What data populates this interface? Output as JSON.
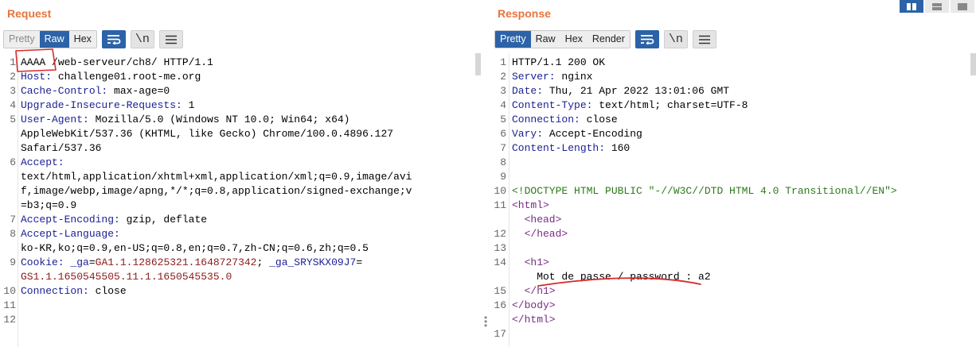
{
  "request": {
    "title": "Request",
    "tabs": [
      "Pretty",
      "Raw",
      "Hex"
    ],
    "active_tab": "Raw",
    "newline_toggle": "\\n",
    "lines": [
      {
        "n": "1",
        "parts": [
          {
            "t": "AAAA",
            "c": "v"
          },
          {
            "t": " /web-serveur/ch8/ HTTP/1.1",
            "c": "v"
          }
        ]
      },
      {
        "n": "2",
        "parts": [
          {
            "t": "Host:",
            "c": "k"
          },
          {
            "t": " challenge01.root-me.org",
            "c": "v"
          }
        ]
      },
      {
        "n": "3",
        "parts": [
          {
            "t": "Cache-Control:",
            "c": "k"
          },
          {
            "t": " max-age=0",
            "c": "v"
          }
        ]
      },
      {
        "n": "4",
        "parts": [
          {
            "t": "Upgrade-Insecure-Requests:",
            "c": "k"
          },
          {
            "t": " 1",
            "c": "v"
          }
        ]
      },
      {
        "n": "5",
        "parts": [
          {
            "t": "User-Agent:",
            "c": "k"
          },
          {
            "t": " Mozilla/5.0 (Windows NT 10.0; Win64; x64)",
            "c": "v"
          }
        ]
      },
      {
        "n": "",
        "parts": [
          {
            "t": "AppleWebKit/537.36 (KHTML, like Gecko) Chrome/100.0.4896.127",
            "c": "v"
          }
        ]
      },
      {
        "n": "",
        "parts": [
          {
            "t": "Safari/537.36",
            "c": "v"
          }
        ]
      },
      {
        "n": "6",
        "parts": [
          {
            "t": "Accept:",
            "c": "k"
          }
        ]
      },
      {
        "n": "",
        "parts": [
          {
            "t": "text/html,application/xhtml+xml,application/xml;q=0.9,image/avi",
            "c": "v"
          }
        ]
      },
      {
        "n": "",
        "parts": [
          {
            "t": "f,image/webp,image/apng,*/*;q=0.8,application/signed-exchange;v",
            "c": "v"
          }
        ]
      },
      {
        "n": "",
        "parts": [
          {
            "t": "=b3;q=0.9",
            "c": "v"
          }
        ]
      },
      {
        "n": "7",
        "parts": [
          {
            "t": "Accept-Encoding:",
            "c": "k"
          },
          {
            "t": " gzip, deflate",
            "c": "v"
          }
        ]
      },
      {
        "n": "8",
        "parts": [
          {
            "t": "Accept-Language:",
            "c": "k"
          }
        ]
      },
      {
        "n": "",
        "parts": [
          {
            "t": "ko-KR,ko;q=0.9,en-US;q=0.8,en;q=0.7,zh-CN;q=0.6,zh;q=0.5",
            "c": "v"
          }
        ]
      },
      {
        "n": "9",
        "parts": [
          {
            "t": "Cookie:",
            "c": "k"
          },
          {
            "t": " _ga",
            "c": "ck"
          },
          {
            "t": "=",
            "c": "v"
          },
          {
            "t": "GA1.1.128625321.1648727342",
            "c": "cv"
          },
          {
            "t": "; ",
            "c": "v"
          },
          {
            "t": "_ga_SRYSKX09J7",
            "c": "ck"
          },
          {
            "t": "=",
            "c": "v"
          }
        ]
      },
      {
        "n": "",
        "parts": [
          {
            "t": "GS1.1.1650545505.11.1.1650545535.0",
            "c": "cv"
          }
        ]
      },
      {
        "n": "10",
        "parts": [
          {
            "t": "Connection:",
            "c": "k"
          },
          {
            "t": " close",
            "c": "v"
          }
        ]
      },
      {
        "n": "11",
        "parts": []
      },
      {
        "n": "12",
        "parts": []
      }
    ]
  },
  "response": {
    "title": "Response",
    "tabs": [
      "Pretty",
      "Raw",
      "Hex",
      "Render"
    ],
    "active_tab": "Pretty",
    "newline_toggle": "\\n",
    "lines": [
      {
        "n": "1",
        "parts": [
          {
            "t": "HTTP/1.1 200 OK",
            "c": "v"
          }
        ]
      },
      {
        "n": "2",
        "parts": [
          {
            "t": "Server:",
            "c": "k"
          },
          {
            "t": " nginx",
            "c": "v"
          }
        ]
      },
      {
        "n": "3",
        "parts": [
          {
            "t": "Date:",
            "c": "k"
          },
          {
            "t": " Thu, 21 Apr 2022 13:01:06 GMT",
            "c": "v"
          }
        ]
      },
      {
        "n": "4",
        "parts": [
          {
            "t": "Content-Type:",
            "c": "k"
          },
          {
            "t": " text/html; charset=UTF-8",
            "c": "v"
          }
        ]
      },
      {
        "n": "5",
        "parts": [
          {
            "t": "Connection:",
            "c": "k"
          },
          {
            "t": " close",
            "c": "v"
          }
        ]
      },
      {
        "n": "6",
        "parts": [
          {
            "t": "Vary:",
            "c": "k"
          },
          {
            "t": " Accept-Encoding",
            "c": "v"
          }
        ]
      },
      {
        "n": "7",
        "parts": [
          {
            "t": "Content-Length:",
            "c": "k"
          },
          {
            "t": " 160",
            "c": "v"
          }
        ]
      },
      {
        "n": "8",
        "parts": []
      },
      {
        "n": "9",
        "parts": []
      },
      {
        "n": "10",
        "parts": [
          {
            "t": "<!DOCTYPE HTML PUBLIC \"-//W3C//DTD HTML 4.0 Transitional//EN\">",
            "c": "dt"
          }
        ]
      },
      {
        "n": "11",
        "parts": [
          {
            "t": "<html>",
            "c": "tag"
          }
        ]
      },
      {
        "n": "",
        "parts": [
          {
            "t": "  <head>",
            "c": "tag"
          }
        ]
      },
      {
        "n": "12",
        "parts": [
          {
            "t": "  </head>",
            "c": "tag"
          }
        ]
      },
      {
        "n": "13",
        "parts": []
      },
      {
        "n": "14",
        "parts": [
          {
            "t": "  <h1>",
            "c": "tag"
          }
        ]
      },
      {
        "n": "",
        "parts": [
          {
            "t": "    Mot de passe / password : a2",
            "c": "v"
          }
        ]
      },
      {
        "n": "15",
        "parts": [
          {
            "t": "  </h1>",
            "c": "tag"
          }
        ]
      },
      {
        "n": "16",
        "parts": [
          {
            "t": "</body>",
            "c": "tag"
          }
        ]
      },
      {
        "n": "",
        "parts": [
          {
            "t": "</html>",
            "c": "tag"
          }
        ]
      },
      {
        "n": "17",
        "parts": []
      }
    ]
  },
  "colors": {
    "accent": "#2c63a8",
    "title": "#e8743b",
    "annotation": "#d62b2b"
  }
}
